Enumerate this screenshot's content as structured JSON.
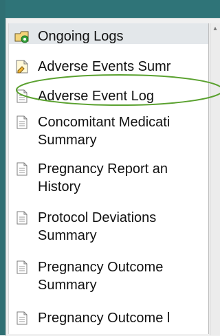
{
  "sidebar": {
    "items": [
      {
        "label": "Ongoing Logs",
        "icon": "ongoing-logs-icon"
      },
      {
        "label": "Adverse Events Sumr",
        "icon": "report-icon"
      },
      {
        "label": "Adverse Event Log",
        "icon": "document-icon"
      },
      {
        "label": "Concomitant Medicati\nSummary",
        "icon": "document-icon"
      },
      {
        "label": "Pregnancy Report an\nHistory",
        "icon": "document-icon"
      },
      {
        "label": "Protocol Deviations\nSummary",
        "icon": "document-icon"
      },
      {
        "label": "Pregnancy Outcome\nSummary",
        "icon": "document-icon"
      },
      {
        "label": "Pregnancy Outcome l",
        "icon": "document-icon"
      }
    ]
  },
  "colors": {
    "header": "#2f7478",
    "selected": "#e3e7ea",
    "annotation": "#5aa12f"
  }
}
